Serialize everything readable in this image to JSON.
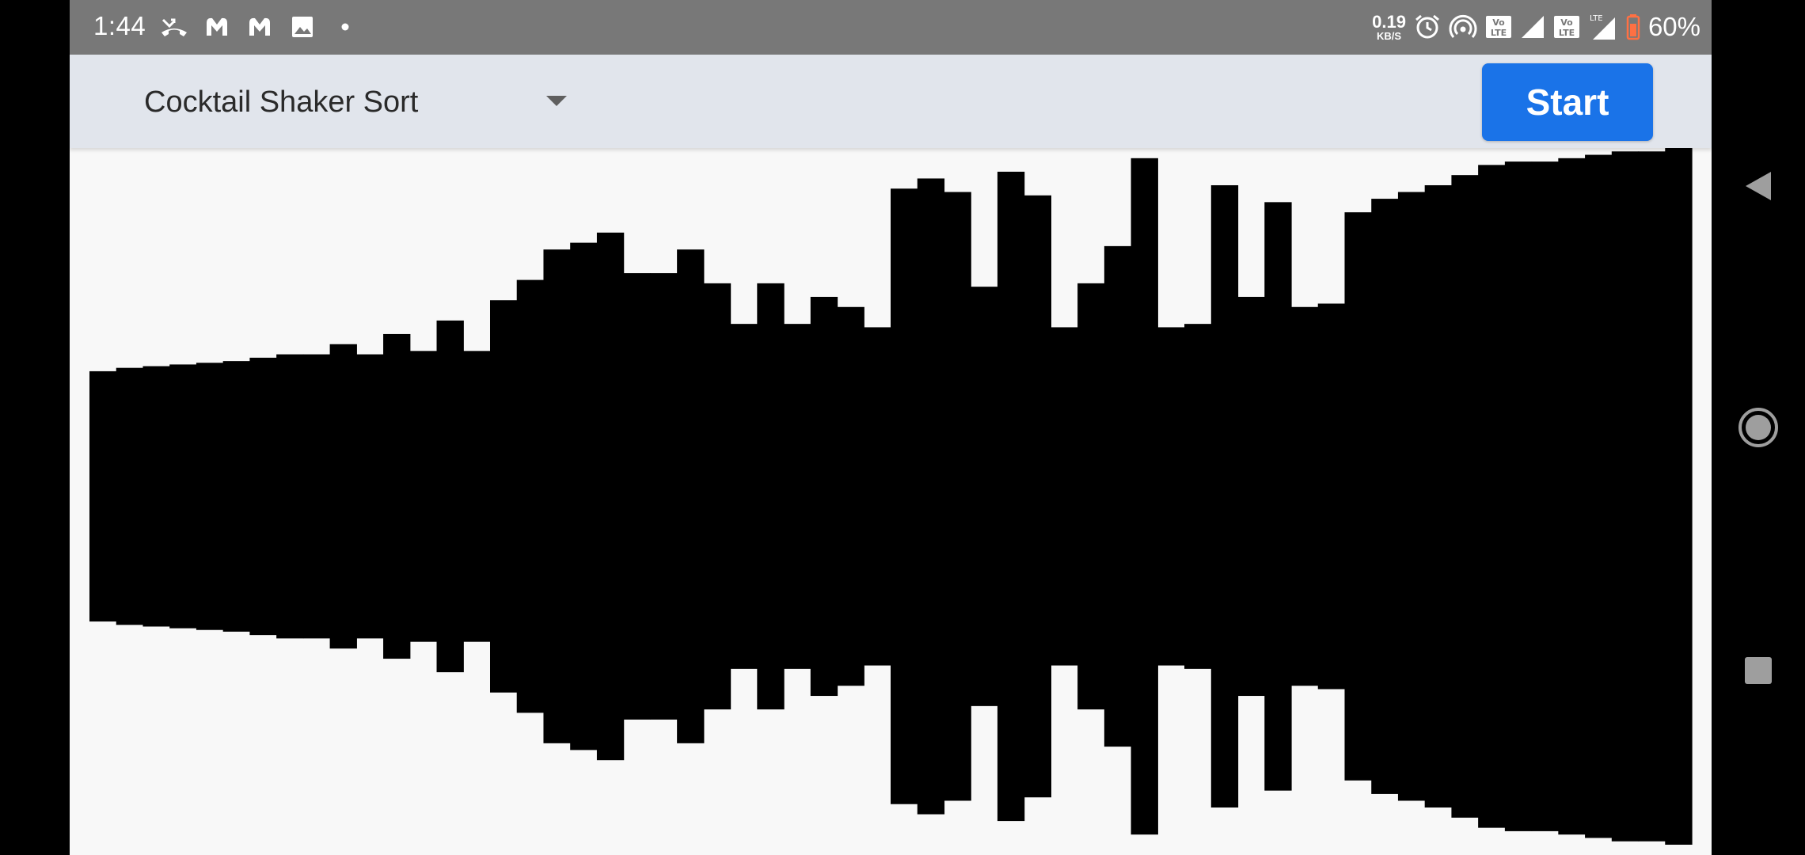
{
  "status_bar": {
    "time": "1:44",
    "left_icons": [
      "missed-call-icon",
      "malwarebytes-icon",
      "malwarebytes-icon",
      "image-icon",
      "dot-icon"
    ],
    "net_speed_value": "0.19",
    "net_speed_unit": "KB/S",
    "volte_label": "Vo LTE",
    "lte_label": "LTE",
    "battery_percent": "60%"
  },
  "toolbar": {
    "algorithm_selected": "Cocktail Shaker Sort",
    "start_label": "Start"
  },
  "colors": {
    "status_bar_bg": "#787878",
    "toolbar_bg": "#e1e5ec",
    "start_button_bg": "#1a73e8",
    "bar_color": "#000000",
    "canvas_bg": "#f8f8f8",
    "battery_accent": "#ff7043"
  },
  "visualization": {
    "type": "sorting-bars",
    "bar_values": [
      37,
      38,
      38.5,
      39,
      39.5,
      40,
      41,
      42,
      42,
      45,
      42,
      48,
      43,
      52,
      43,
      58,
      64,
      73,
      75,
      78,
      66,
      66,
      73,
      63,
      51,
      63,
      51,
      59,
      56,
      50,
      91,
      94,
      90,
      62,
      96,
      89,
      50,
      63,
      74,
      100,
      50,
      51,
      92,
      59,
      87,
      56,
      57,
      84,
      88,
      90,
      92,
      95,
      98,
      99,
      99,
      100,
      101,
      102,
      102,
      103
    ],
    "max_value": 103
  },
  "nav_bar": {
    "buttons": [
      "back-icon",
      "home-icon",
      "recents-icon"
    ]
  }
}
